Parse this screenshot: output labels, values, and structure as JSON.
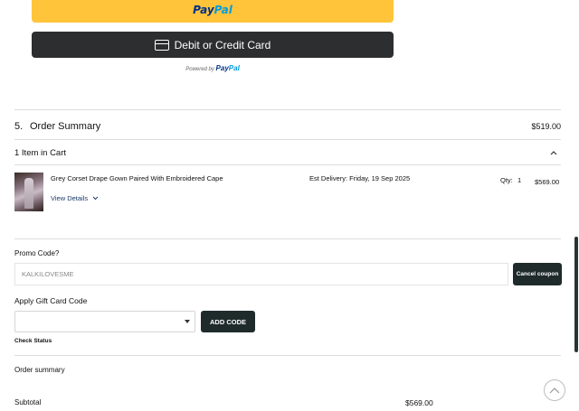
{
  "payment": {
    "paypal_logo_part1": "Pay",
    "paypal_logo_part2": "Pal",
    "card_button_label": "Debit or Credit Card",
    "powered_by_prefix": "Powered by",
    "powered_by_brand_part1": "Pay",
    "powered_by_brand_part2": "Pal"
  },
  "order_summary": {
    "number": "5.",
    "title": "Order Summary",
    "total": "$519.00",
    "cart_count": "1 Item in Cart",
    "cart_toggle_icon": "chevron-up-icon"
  },
  "cart": {
    "items": [
      {
        "name": "Grey Corset Drape Gown Paired With Embroidered Cape",
        "view_details": "View Details",
        "est_delivery": "Est Delivery: Friday, 19 Sep 2025",
        "qty_label": "Qty:",
        "qty": "1",
        "price": "$569.00"
      }
    ]
  },
  "promo": {
    "label": "Promo Code?",
    "value": "KALKILOVESME",
    "cancel_button": "Cancel coupon"
  },
  "gift_card": {
    "label": "Apply Gift Card Code",
    "selected": "",
    "add_button": "ADD CODE",
    "check_status": "Check Status"
  },
  "summary": {
    "label": "Order summary",
    "subtotal_label": "Subtotal",
    "subtotal_value": "$569.00"
  },
  "colors": {
    "paypal_yellow": "#ffc439",
    "paypal_dark_blue": "#003087",
    "paypal_light_blue": "#009cde",
    "card_button": "#2c2e2f",
    "dark_button": "#1f2b2b"
  }
}
